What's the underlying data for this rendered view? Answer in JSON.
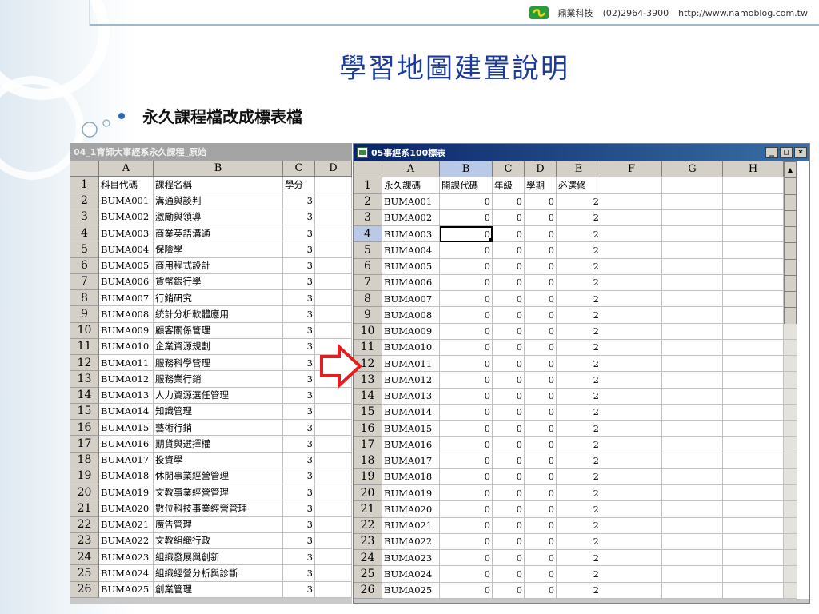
{
  "header": {
    "company": "鼎業科技",
    "phone": "(02)2964-3900",
    "url": "http://www.namoblog.com.tw"
  },
  "title": "學習地圖建置說明",
  "bullet": "永久課程檔改成標表檔",
  "colors": {
    "title": "#1a3a9e",
    "bullet": "#2b63b7",
    "arrow": "#e02020",
    "logo": "#2d9a3a"
  },
  "left_sheet": {
    "window_title": "04_1育師大事經系永久課程_原始",
    "columns": [
      "A",
      "B",
      "C",
      "D"
    ],
    "rows": [
      [
        "1",
        "科目代碼",
        "課程名稱",
        "學分"
      ],
      [
        "2",
        "BUMA001",
        "溝通與談判",
        "3"
      ],
      [
        "3",
        "BUMA002",
        "激勵與領導",
        "3"
      ],
      [
        "4",
        "BUMA003",
        "商業英語溝通",
        "3"
      ],
      [
        "5",
        "BUMA004",
        "保險學",
        "3"
      ],
      [
        "6",
        "BUMA005",
        "商用程式設計",
        "3"
      ],
      [
        "7",
        "BUMA006",
        "貨幣銀行學",
        "3"
      ],
      [
        "8",
        "BUMA007",
        "行銷研究",
        "3"
      ],
      [
        "9",
        "BUMA008",
        "統計分析軟體應用",
        "3"
      ],
      [
        "10",
        "BUMA009",
        "顧客關係管理",
        "3"
      ],
      [
        "11",
        "BUMA010",
        "企業資源規劃",
        "3"
      ],
      [
        "12",
        "BUMA011",
        "服務科學管理",
        "3"
      ],
      [
        "13",
        "BUMA012",
        "服務業行銷",
        "3"
      ],
      [
        "14",
        "BUMA013",
        "人力資源選任管理",
        "3"
      ],
      [
        "15",
        "BUMA014",
        "知識管理",
        "3"
      ],
      [
        "16",
        "BUMA015",
        "藝術行銷",
        "3"
      ],
      [
        "17",
        "BUMA016",
        "期貨與選擇權",
        "3"
      ],
      [
        "18",
        "BUMA017",
        "投資學",
        "3"
      ],
      [
        "19",
        "BUMA018",
        "休閒事業經營管理",
        "3"
      ],
      [
        "20",
        "BUMA019",
        "文教事業經營管理",
        "3"
      ],
      [
        "21",
        "BUMA020",
        "數位科技事業經營管理",
        "3"
      ],
      [
        "22",
        "BUMA021",
        "廣告管理",
        "3"
      ],
      [
        "23",
        "BUMA022",
        "文教組織行政",
        "3"
      ],
      [
        "24",
        "BUMA023",
        "組織發展與創新",
        "3"
      ],
      [
        "25",
        "BUMA024",
        "組織經營分析與診斷",
        "3"
      ],
      [
        "26",
        "BUMA025",
        "創業管理",
        "3"
      ]
    ]
  },
  "right_sheet": {
    "window_title": "05事經系100標表",
    "window_buttons": [
      "_",
      "□",
      "×"
    ],
    "columns": [
      "A",
      "B",
      "C",
      "D",
      "E",
      "F",
      "G",
      "H"
    ],
    "active_column": "B",
    "active_row": "4",
    "rows": [
      [
        "1",
        "永久課碼",
        "開課代碼",
        "年級",
        "學期",
        "必選修"
      ],
      [
        "2",
        "BUMA001",
        "0",
        "0",
        "0",
        "2"
      ],
      [
        "3",
        "BUMA002",
        "0",
        "0",
        "0",
        "2"
      ],
      [
        "4",
        "BUMA003",
        "0",
        "0",
        "0",
        "2"
      ],
      [
        "5",
        "BUMA004",
        "0",
        "0",
        "0",
        "2"
      ],
      [
        "6",
        "BUMA005",
        "0",
        "0",
        "0",
        "2"
      ],
      [
        "7",
        "BUMA006",
        "0",
        "0",
        "0",
        "2"
      ],
      [
        "8",
        "BUMA007",
        "0",
        "0",
        "0",
        "2"
      ],
      [
        "9",
        "BUMA008",
        "0",
        "0",
        "0",
        "2"
      ],
      [
        "10",
        "BUMA009",
        "0",
        "0",
        "0",
        "2"
      ],
      [
        "11",
        "BUMA010",
        "0",
        "0",
        "0",
        "2"
      ],
      [
        "12",
        "BUMA011",
        "0",
        "0",
        "0",
        "2"
      ],
      [
        "13",
        "BUMA012",
        "0",
        "0",
        "0",
        "2"
      ],
      [
        "14",
        "BUMA013",
        "0",
        "0",
        "0",
        "2"
      ],
      [
        "15",
        "BUMA014",
        "0",
        "0",
        "0",
        "2"
      ],
      [
        "16",
        "BUMA015",
        "0",
        "0",
        "0",
        "2"
      ],
      [
        "17",
        "BUMA016",
        "0",
        "0",
        "0",
        "2"
      ],
      [
        "18",
        "BUMA017",
        "0",
        "0",
        "0",
        "2"
      ],
      [
        "19",
        "BUMA018",
        "0",
        "0",
        "0",
        "2"
      ],
      [
        "20",
        "BUMA019",
        "0",
        "0",
        "0",
        "2"
      ],
      [
        "21",
        "BUMA020",
        "0",
        "0",
        "0",
        "2"
      ],
      [
        "22",
        "BUMA021",
        "0",
        "0",
        "0",
        "2"
      ],
      [
        "23",
        "BUMA022",
        "0",
        "0",
        "0",
        "2"
      ],
      [
        "24",
        "BUMA023",
        "0",
        "0",
        "0",
        "2"
      ],
      [
        "25",
        "BUMA024",
        "0",
        "0",
        "0",
        "2"
      ],
      [
        "26",
        "BUMA025",
        "0",
        "0",
        "0",
        "2"
      ]
    ]
  }
}
